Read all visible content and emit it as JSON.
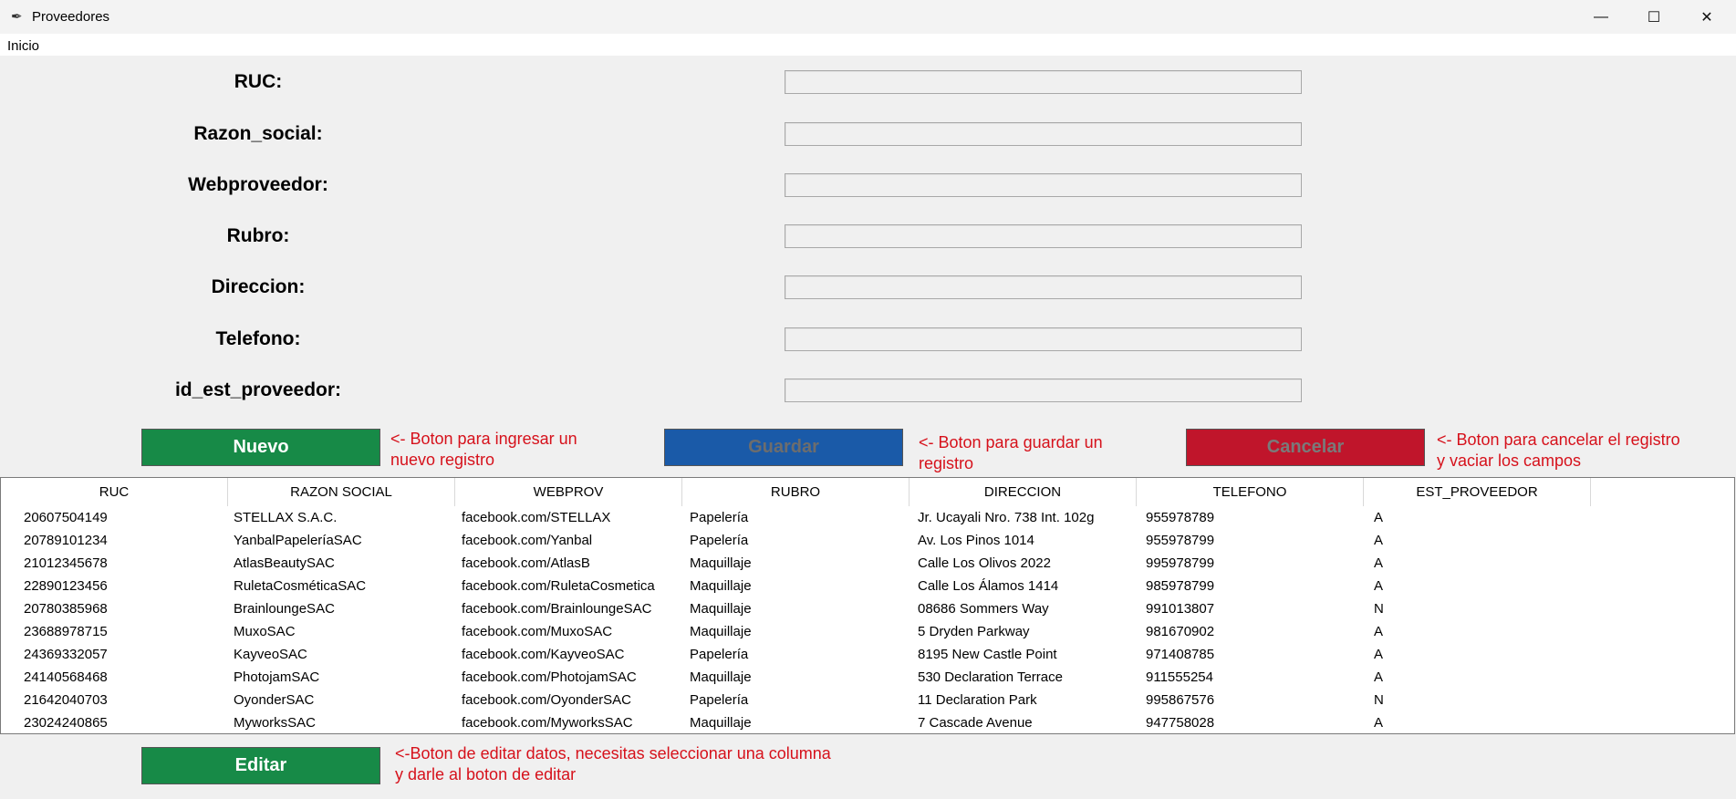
{
  "window": {
    "title": "Proveedores",
    "minimize": "—",
    "maximize": "☐",
    "close": "✕"
  },
  "menu": {
    "inicio": "Inicio"
  },
  "form": {
    "fields": [
      {
        "label": "RUC:",
        "value": ""
      },
      {
        "label": "Razon_social:",
        "value": ""
      },
      {
        "label": "Webproveedor:",
        "value": ""
      },
      {
        "label": "Rubro:",
        "value": ""
      },
      {
        "label": "Direccion:",
        "value": ""
      },
      {
        "label": "Telefono:",
        "value": ""
      },
      {
        "label": "id_est_proveedor:",
        "value": ""
      }
    ]
  },
  "buttons": {
    "nuevo": "Nuevo",
    "guardar": "Guardar",
    "cancelar": "Cancelar",
    "editar": "Editar"
  },
  "notes": {
    "nuevo": "<- Boton para ingresar un\nnuevo registro",
    "guardar": "<- Boton para guardar un\nregistro",
    "cancelar": "<- Boton para cancelar el registro\ny vaciar los campos",
    "editar": "<-Boton de editar datos, necesitas seleccionar una columna\ny darle al boton de editar"
  },
  "table": {
    "columns": [
      "RUC",
      "RAZON SOCIAL",
      "WEBPROV",
      "RUBRO",
      "DIRECCION",
      "TELEFONO",
      "EST_PROVEEDOR"
    ],
    "rows": [
      [
        "20607504149",
        "STELLAX S.A.C.",
        "facebook.com/STELLAX",
        "Papelería",
        "Jr. Ucayali Nro. 738 Int. 102g",
        "955978789",
        "A"
      ],
      [
        "20789101234",
        "YanbalPapeleríaSAC",
        "facebook.com/Yanbal",
        "Papelería",
        "Av. Los Pinos 1014",
        "955978799",
        "A"
      ],
      [
        "21012345678",
        "AtlasBeautySAC",
        "facebook.com/AtlasB",
        "Maquillaje",
        "Calle Los Olivos 2022",
        "995978799",
        "A"
      ],
      [
        "22890123456",
        "RuletaCosméticaSAC",
        "facebook.com/RuletaCosmetica",
        "Maquillaje",
        "Calle Los Álamos 1414",
        "985978799",
        "A"
      ],
      [
        "20780385968",
        "BrainloungeSAC",
        "facebook.com/BrainloungeSAC",
        "Maquillaje",
        "08686 Sommers Way",
        "991013807",
        "N"
      ],
      [
        "23688978715",
        "MuxoSAC",
        "facebook.com/MuxoSAC",
        "Maquillaje",
        "5 Dryden Parkway",
        "981670902",
        "A"
      ],
      [
        "24369332057",
        "KayveoSAC",
        "facebook.com/KayveoSAC",
        "Papelería",
        "8195 New Castle Point",
        "971408785",
        "A"
      ],
      [
        "24140568468",
        "PhotojamSAC",
        "facebook.com/PhotojamSAC",
        "Maquillaje",
        "530 Declaration Terrace",
        "911555254",
        "A"
      ],
      [
        "21642040703",
        "OyonderSAC",
        "facebook.com/OyonderSAC",
        "Papelería",
        "11 Declaration Park",
        "995867576",
        "N"
      ],
      [
        "23024240865",
        "MyworksSAC",
        "facebook.com/MyworksSAC",
        "Maquillaje",
        "7 Cascade Avenue",
        "947758028",
        "A"
      ]
    ]
  }
}
